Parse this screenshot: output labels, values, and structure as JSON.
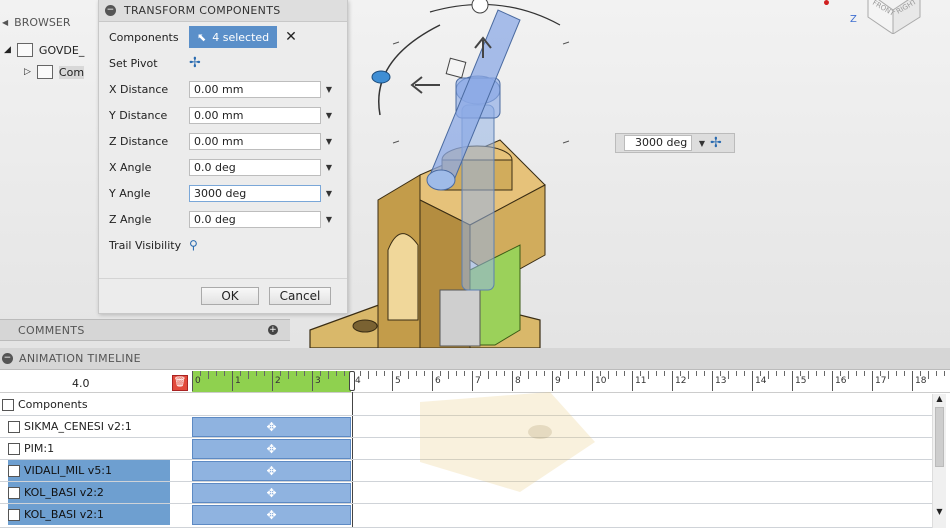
{
  "browser": {
    "title": "BROWSER",
    "root_label": "GOVDE_",
    "child_label": "Com"
  },
  "dialog": {
    "title": "TRANSFORM COMPONENTS",
    "components_label": "Components",
    "selected_text": "4 selected",
    "set_pivot_label": "Set Pivot",
    "fields": [
      {
        "label": "X Distance",
        "value": "0.00 mm"
      },
      {
        "label": "Y Distance",
        "value": "0.00 mm"
      },
      {
        "label": "Z Distance",
        "value": "0.00 mm"
      },
      {
        "label": "X Angle",
        "value": "0.0 deg"
      },
      {
        "label": "Y Angle",
        "value": "3000 deg"
      },
      {
        "label": "Z Angle",
        "value": "0.0 deg"
      }
    ],
    "trail_label": "Trail Visibility",
    "ok_label": "OK",
    "cancel_label": "Cancel"
  },
  "viewport": {
    "floating_value": "3000 deg",
    "viewcube_front": "FRONT",
    "viewcube_right": "RIGHT"
  },
  "comments": {
    "title": "COMMENTS"
  },
  "timeline": {
    "title": "ANIMATION TIMELINE",
    "time_value": "4.0",
    "ruler_ticks": [
      "0",
      "1",
      "2",
      "3",
      "4",
      "5",
      "6",
      "7",
      "8",
      "9",
      "10",
      "11",
      "12",
      "13",
      "14",
      "15",
      "16",
      "17",
      "18"
    ],
    "root_label": "Components",
    "tracks": [
      {
        "name": "SIKMA_CENESI v2:1",
        "selected": false
      },
      {
        "name": "PIM:1",
        "selected": false
      },
      {
        "name": "VIDALI_MIL v5:1",
        "selected": true
      },
      {
        "name": "KOL_BASI v2:2",
        "selected": true
      },
      {
        "name": "KOL_BASI v2:1",
        "selected": true
      }
    ]
  },
  "colors": {
    "accent": "#5a8fc9",
    "selection": "#6e9fd0",
    "bar": "#8fb3e0",
    "played": "#8fd14f"
  }
}
